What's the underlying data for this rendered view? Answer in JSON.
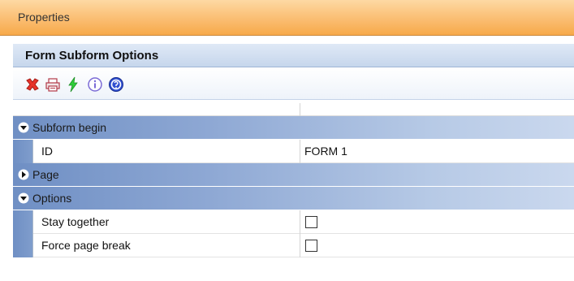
{
  "panel": {
    "title": "Properties",
    "header": "Form Subform Options"
  },
  "toolbar": {
    "buttons": [
      {
        "icon": "delete-icon",
        "color": "#e8332a"
      },
      {
        "icon": "print-icon",
        "color": "#b23a48"
      },
      {
        "icon": "lightning-icon",
        "color": "#2fcf3a"
      },
      {
        "icon": "info-icon",
        "color": "#7b6bd6"
      },
      {
        "icon": "help-icon",
        "color": "#2f4fd0"
      }
    ]
  },
  "grid": {
    "categories": [
      {
        "label": "Subform begin",
        "expanded": true,
        "properties": [
          {
            "name": "ID",
            "value": "FORM 1",
            "type": "text"
          }
        ]
      },
      {
        "label": "Page",
        "expanded": false,
        "properties": []
      },
      {
        "label": "Options",
        "expanded": true,
        "properties": [
          {
            "name": "Stay together",
            "value": "",
            "type": "checkbox",
            "checked": false
          },
          {
            "name": "Force page break",
            "value": "",
            "type": "checkbox",
            "checked": false
          }
        ]
      }
    ]
  },
  "colors": {
    "titlebar": "#f7a94a",
    "category_band": "#7f9dcc",
    "header_band": "#c6d6ec"
  }
}
